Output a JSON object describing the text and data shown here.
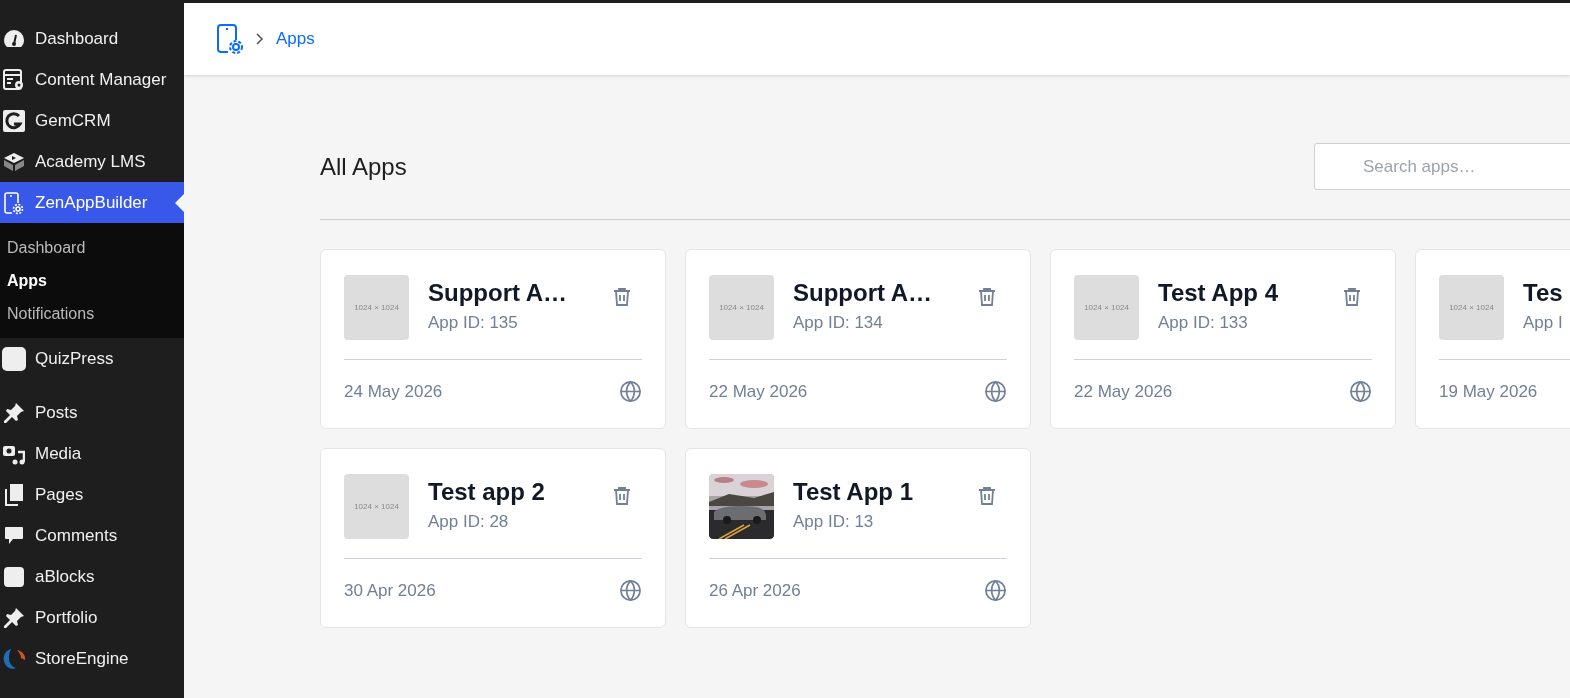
{
  "sidebar": {
    "items": [
      {
        "label": "Dashboard",
        "selected": false
      },
      {
        "label": "Content Manager",
        "selected": false
      },
      {
        "label": "GemCRM",
        "selected": false
      },
      {
        "label": "Academy LMS",
        "selected": false
      },
      {
        "label": "ZenAppBuilder",
        "selected": true,
        "children": [
          {
            "label": "Dashboard",
            "selected": false
          },
          {
            "label": "Apps",
            "selected": true
          },
          {
            "label": "Notifications",
            "selected": false
          }
        ]
      },
      {
        "label": "QuizPress",
        "selected": false
      },
      {
        "label": "Posts",
        "selected": false
      },
      {
        "label": "Media",
        "selected": false
      },
      {
        "label": "Pages",
        "selected": false
      },
      {
        "label": "Comments",
        "selected": false
      },
      {
        "label": "aBlocks",
        "selected": false
      },
      {
        "label": "Portfolio",
        "selected": false
      },
      {
        "label": "StoreEngine",
        "selected": false
      }
    ]
  },
  "breadcrumb": {
    "current": "Apps"
  },
  "heading": "All Apps",
  "search": {
    "placeholder": "Search apps…"
  },
  "apps": [
    {
      "title": "Support A…",
      "app_id": "App ID: 135",
      "date": "24 May 2026",
      "image": {
        "kind": "placeholder",
        "text": "1024 × 1024"
      }
    },
    {
      "title": "Support A…",
      "app_id": "App ID: 134",
      "date": "22 May 2026",
      "image": {
        "kind": "placeholder",
        "text": "1024 × 1024"
      }
    },
    {
      "title": "Test App 4",
      "app_id": "App ID: 133",
      "date": "22 May 2026",
      "image": {
        "kind": "placeholder",
        "text": "1024 × 1024"
      }
    },
    {
      "title": "Tes",
      "app_id": "App I",
      "date": "19 May 2026",
      "cut_off": true,
      "image": {
        "kind": "placeholder",
        "text": "1024 × 1024"
      }
    },
    {
      "title": "Test app 2",
      "app_id": "App ID: 28",
      "date": "30 Apr 2026",
      "image": {
        "kind": "placeholder",
        "text": "1024 × 1024"
      }
    },
    {
      "title": "Test App 1",
      "app_id": "App ID: 13",
      "date": "26 Apr 2026"
    }
  ]
}
